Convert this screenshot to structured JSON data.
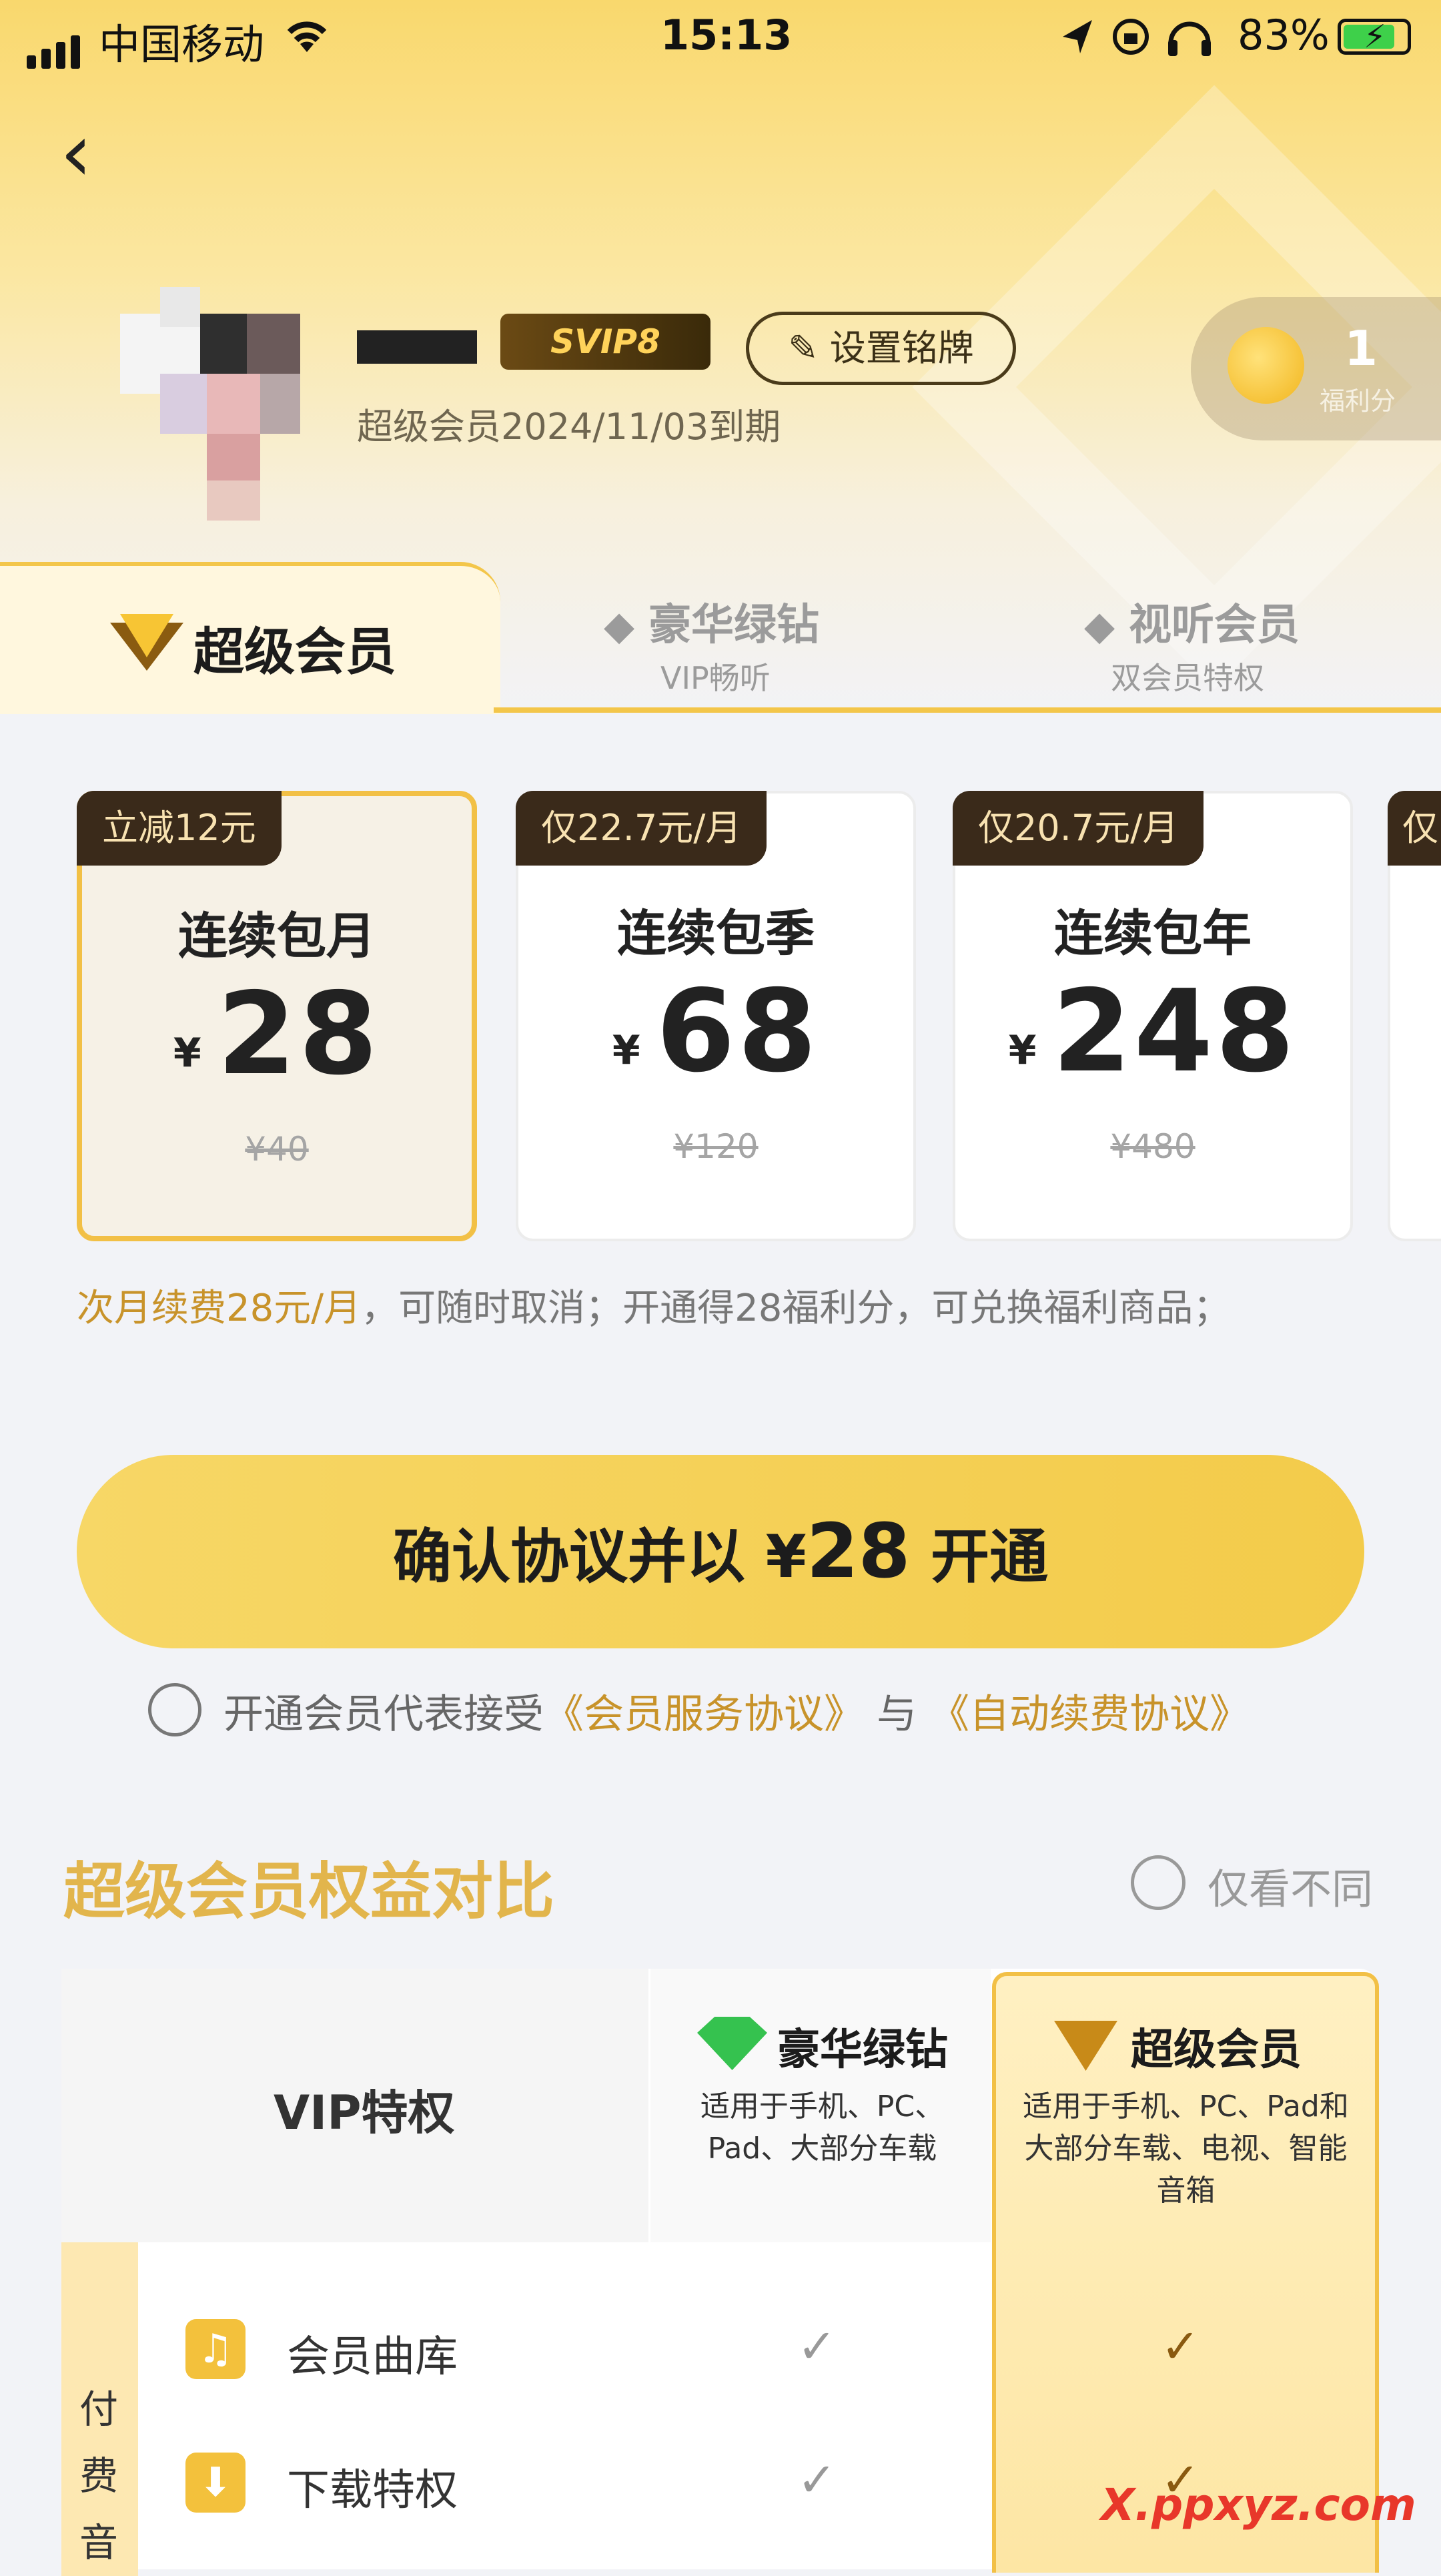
{
  "status_bar": {
    "carrier": "中国移动",
    "time": "15:13",
    "battery_pct": "83%",
    "battery_level": 0.83
  },
  "profile": {
    "badge": "SVIP8",
    "nameplate_button": "设置铭牌",
    "expire_text": "超级会员2024/11/03到期",
    "points_value": "1",
    "points_label": "福利分"
  },
  "tabs": [
    {
      "label": "超级会员",
      "sub": ""
    },
    {
      "label": "豪华绿钻",
      "sub": "VIP畅听"
    },
    {
      "label": "视听会员",
      "sub": "双会员特权"
    }
  ],
  "plans": [
    {
      "tag": "立减12元",
      "name": "连续包月",
      "currency": "¥",
      "price": "28",
      "original": "¥40",
      "selected": true
    },
    {
      "tag": "仅22.7元/月",
      "name": "连续包季",
      "currency": "¥",
      "price": "68",
      "original": "¥120",
      "selected": false
    },
    {
      "tag": "仅20.7元/月",
      "name": "连续包年",
      "currency": "¥",
      "price": "248",
      "original": "¥480",
      "selected": false
    },
    {
      "tag": "仅"
    }
  ],
  "note": {
    "highlight": "次月续费28元/月",
    "rest": "，可随时取消；开通得28福利分，可兑换福利商品；"
  },
  "cta": {
    "prefix": "确认协议并以 ¥",
    "amount": "28",
    "suffix": " 开通"
  },
  "agreement": {
    "text": "开通会员代表接受",
    "link1": "《会员服务协议》",
    "joiner": "与",
    "link2": "《自动续费协议》"
  },
  "compare": {
    "title": "超级会员权益对比",
    "only_diff": "仅看不同",
    "header_left": "VIP特权",
    "col_green": {
      "name": "豪华绿钻",
      "desc": "适用于手机、PC、Pad、大部分车载"
    },
    "col_super": {
      "name": "超级会员",
      "desc": "适用于手机、PC、Pad和大部分车载、电视、智能音箱"
    },
    "side_group": "付费音",
    "rows": [
      {
        "label": "会员曲库"
      },
      {
        "label": "下载特权"
      }
    ]
  },
  "watermark": "X.ppxyz.com",
  "icons": [
    "signal-icon",
    "wifi-icon",
    "location-icon",
    "lock-rotation-icon",
    "headphones-icon",
    "battery-icon",
    "back-icon",
    "coin-icon",
    "edit-icon",
    "vip-diamond-icon",
    "green-diamond-icon",
    "music-note-icon",
    "download-icon",
    "check-icon"
  ]
}
